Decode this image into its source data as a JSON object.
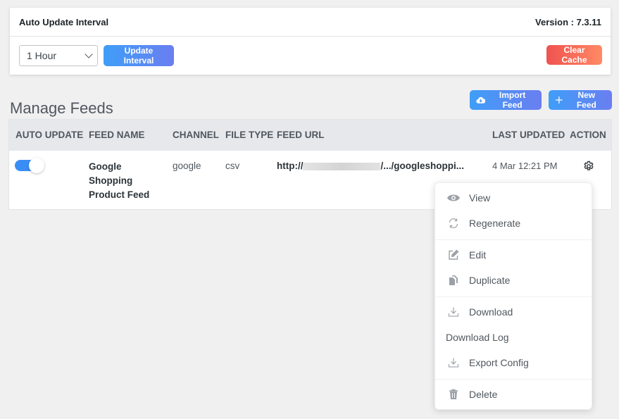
{
  "settings": {
    "title": "Auto Update Interval",
    "version": "Version : 7.3.11",
    "interval_selected": "1 Hour",
    "update_button": "Update Interval",
    "clear_cache_button": "Clear Cache"
  },
  "manage": {
    "title": "Manage Feeds",
    "import_button": "Import Feed",
    "new_button": "New Feed"
  },
  "table": {
    "headers": [
      "AUTO UPDATE",
      "FEED NAME",
      "CHANNEL",
      "FILE TYPE",
      "FEED URL",
      "LAST UPDATED",
      "ACTION"
    ],
    "rows": [
      {
        "auto_update": true,
        "feed_name_lines": [
          "Google",
          "Shopping",
          "Product Feed"
        ],
        "channel": "google",
        "file_type": "csv",
        "url_prefix": "http://",
        "url_suffix": "/.../googleshoppi...",
        "last_updated": "4 Mar 12:21 PM"
      }
    ]
  },
  "action_menu": {
    "items": [
      {
        "label": "View",
        "icon": "eye-icon"
      },
      {
        "label": "Regenerate",
        "icon": "refresh-icon"
      },
      {
        "label": "Edit",
        "icon": "edit-icon"
      },
      {
        "label": "Duplicate",
        "icon": "duplicate-icon"
      },
      {
        "label": "Download",
        "icon": "download-icon"
      },
      {
        "label": "Download Log",
        "icon": ""
      },
      {
        "label": "Export Config",
        "icon": "download-icon"
      },
      {
        "label": "Delete",
        "icon": "trash-icon"
      }
    ]
  }
}
